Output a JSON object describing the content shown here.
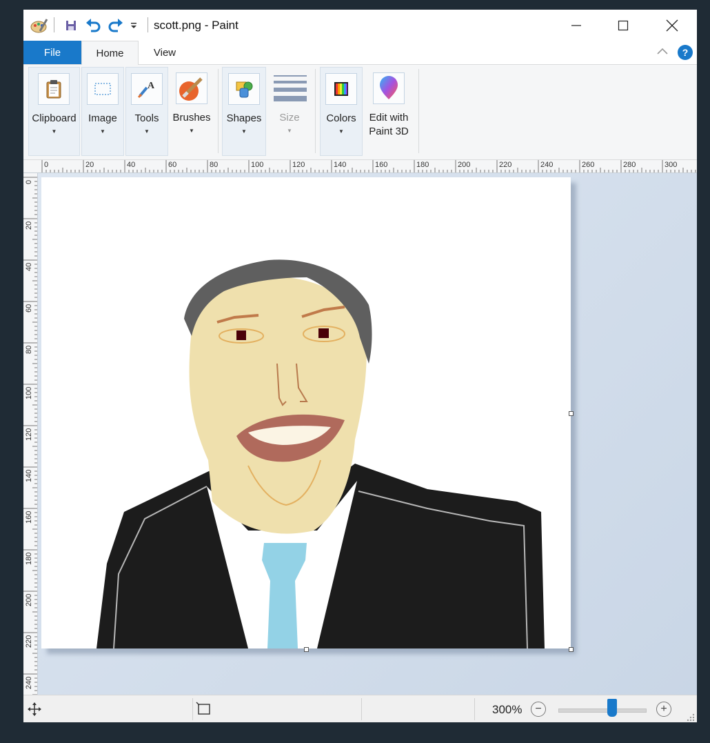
{
  "window": {
    "title": "scott.png - Paint"
  },
  "tabs": [
    {
      "label": "File"
    },
    {
      "label": "Home"
    },
    {
      "label": "View"
    }
  ],
  "ribbon": {
    "clipboard": "Clipboard",
    "image": "Image",
    "tools": "Tools",
    "brushes": "Brushes",
    "shapes": "Shapes",
    "size": "Size",
    "colors": "Colors",
    "paint3d_line1": "Edit with",
    "paint3d_line2": "Paint 3D"
  },
  "ruler": {
    "top": [
      "0",
      "20",
      "40",
      "60",
      "80",
      "100",
      "120",
      "140",
      "160",
      "180",
      "200",
      "220",
      "240",
      "260",
      "280",
      "300"
    ],
    "left": [
      "0",
      "20",
      "40",
      "60",
      "80",
      "100",
      "120",
      "140",
      "160",
      "180",
      "200",
      "220",
      "240"
    ]
  },
  "status": {
    "zoom": "300%",
    "zoom_slider_fraction": 0.62
  },
  "colors": {
    "accent": "#1979ca",
    "suit": "#1c1c1c",
    "tie": "#93d2e6",
    "skin": "#efe0ad",
    "hair": "#5f5f5f"
  }
}
